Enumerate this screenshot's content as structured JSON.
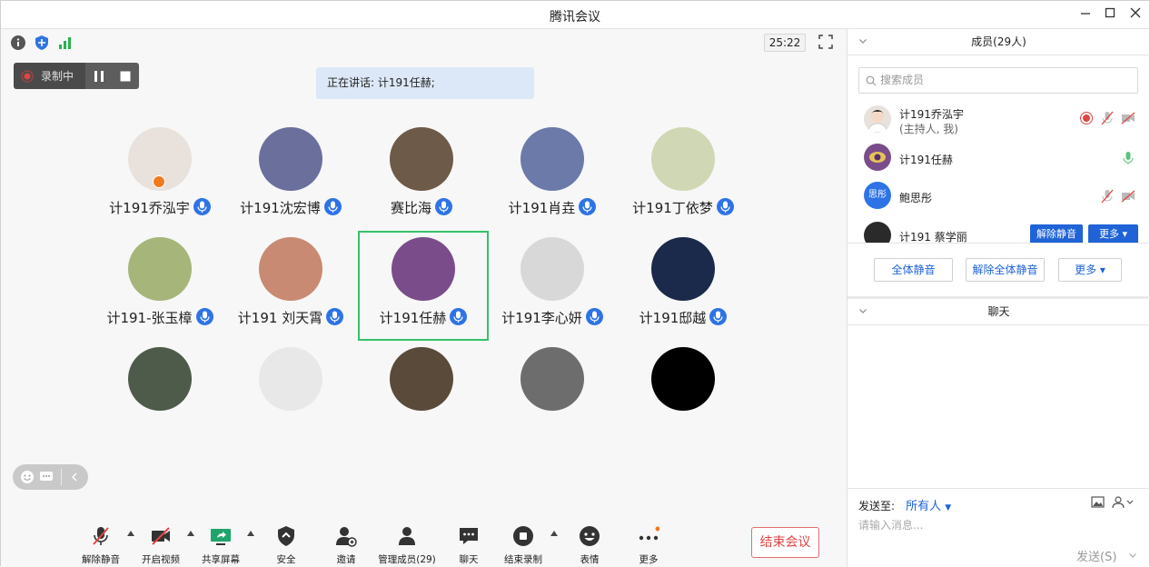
{
  "window": {
    "title": "腾讯会议"
  },
  "timer": "25:22",
  "recording": {
    "label": "录制中"
  },
  "speaking": "正在讲话: 计191任赫;",
  "participants": [
    {
      "name": "计191乔泓宇",
      "color": "#e9e2dc"
    },
    {
      "name": "计191沈宏博",
      "color": "#6a6f9c"
    },
    {
      "name": "赛比海",
      "color": "#6e5a48"
    },
    {
      "name": "计191肖垚",
      "color": "#6b7aa8"
    },
    {
      "name": "计191丁依梦",
      "color": "#cfd7b4"
    },
    {
      "name": "计191-张玉樟",
      "color": "#a6b57a"
    },
    {
      "name": "计191 刘天霄",
      "color": "#c88a72"
    },
    {
      "name": "计191任赫",
      "color": "#7a4d8a"
    },
    {
      "name": "计191李心妍",
      "color": "#d8d8d8"
    },
    {
      "name": "计191邸越",
      "color": "#1b2a4a"
    },
    {
      "name": "",
      "color": "#4f5b4a"
    },
    {
      "name": "",
      "color": "#e8e8e8"
    },
    {
      "name": "",
      "color": "#5a4a3a"
    },
    {
      "name": "",
      "color": "#6d6d6d"
    },
    {
      "name": "",
      "color": "#000000"
    }
  ],
  "toolbar": {
    "unmute": "解除静音",
    "video": "开启视频",
    "share": "共享屏幕",
    "security": "安全",
    "invite": "邀请",
    "manage": "管理成员(29)",
    "chat": "聊天",
    "stop_rec": "结束录制",
    "emoji": "表情",
    "more": "更多",
    "end": "结束会议"
  },
  "sidebar": {
    "members_title": "成员(29人)",
    "search_placeholder": "搜索成员",
    "members": [
      {
        "name": "计191乔泓宇",
        "sub": "(主持人, 我)"
      },
      {
        "name": "计191任赫",
        "sub": ""
      },
      {
        "name": "鲍思彤",
        "sub": "",
        "avatar_text": "思彤"
      },
      {
        "name": "计191 蔡学丽",
        "sub": ""
      }
    ],
    "unmute_btn": "解除静音",
    "more_btn": "更多",
    "mute_all": "全体静音",
    "unmute_all": "解除全体静音",
    "more": "更多",
    "chat_title": "聊天",
    "send_to_label": "发送至:",
    "send_to_value": "所有人",
    "input_placeholder": "请输入消息...",
    "send": "发送(S)"
  },
  "colors": {
    "accent": "#2e73e6",
    "active_border": "#35c168",
    "end_red": "#e04545"
  }
}
